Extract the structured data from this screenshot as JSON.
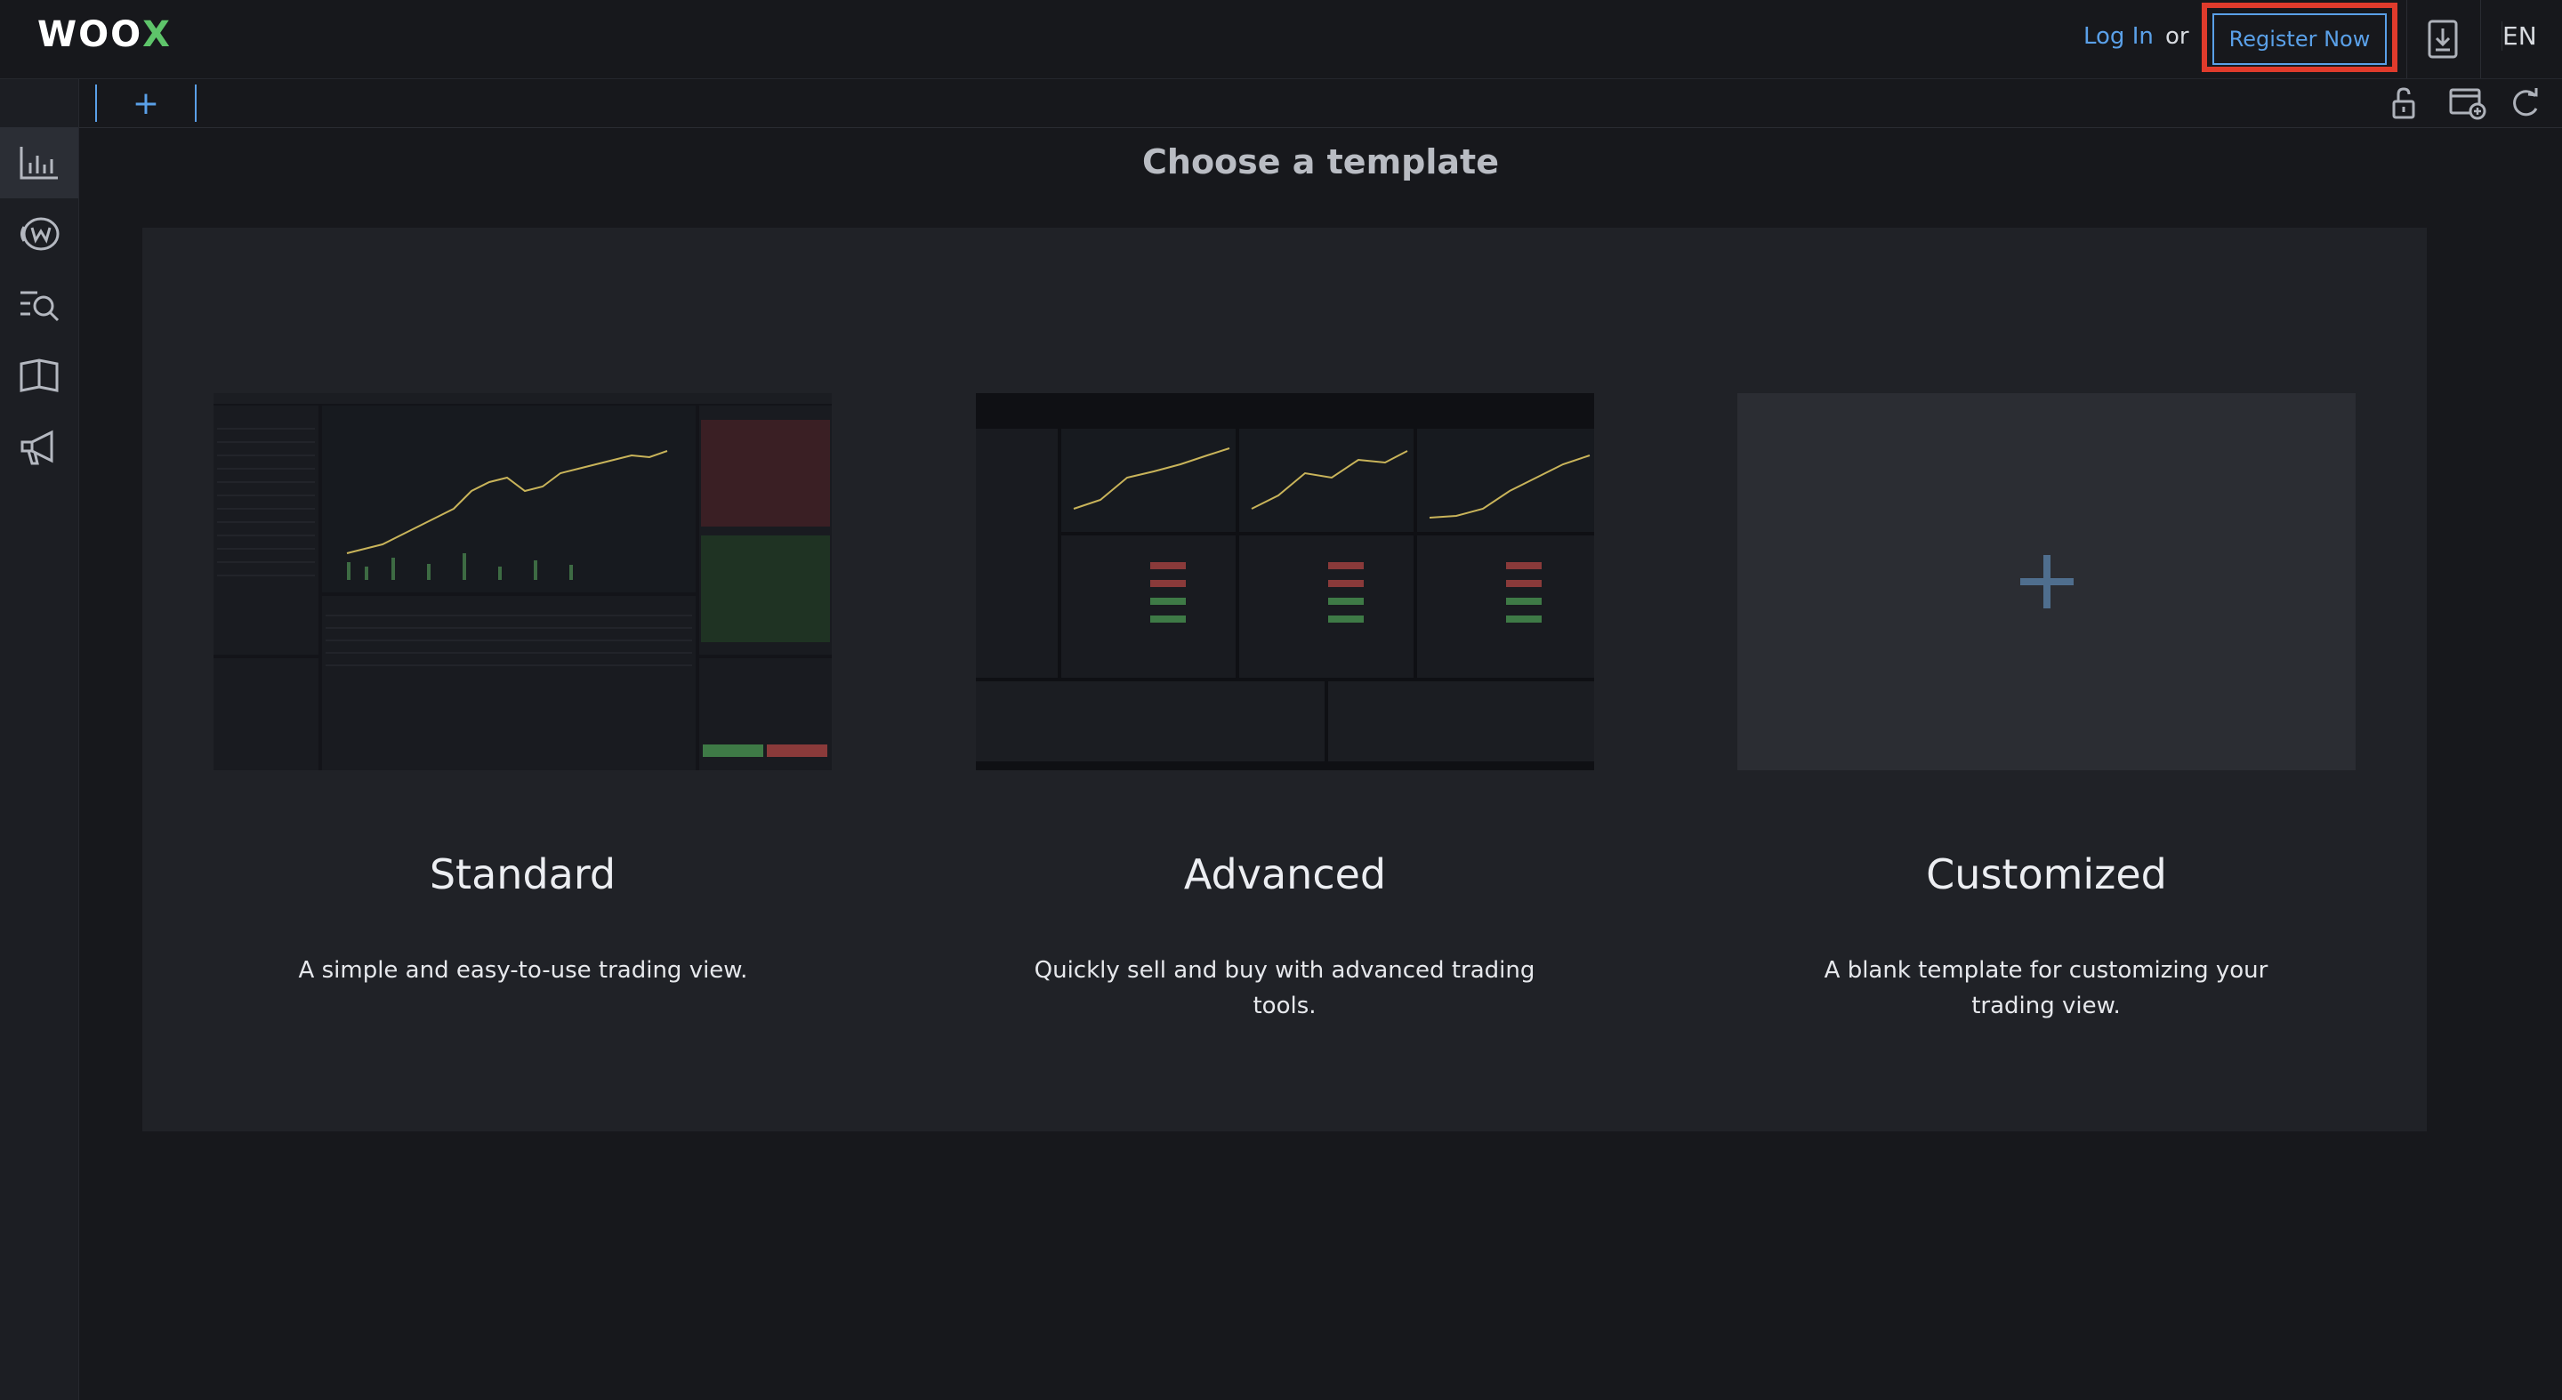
{
  "header": {
    "logo_main": "WOO",
    "logo_accent": "X",
    "login_label": "Log In",
    "or_label": "or",
    "register_label": "Register Now",
    "language_label": "EN"
  },
  "tabs": {
    "add_label": "+"
  },
  "sidebar": {
    "items": [
      {
        "icon": "chart-bars-icon",
        "active": true
      },
      {
        "icon": "woo-token-icon",
        "active": false
      },
      {
        "icon": "search-list-icon",
        "active": false
      },
      {
        "icon": "book-icon",
        "active": false
      },
      {
        "icon": "megaphone-icon",
        "active": false
      }
    ]
  },
  "toolbar_icons": [
    "unlock-icon",
    "window-add-icon",
    "refresh-icon"
  ],
  "main": {
    "title": "Choose a template",
    "templates": [
      {
        "name": "Standard",
        "description": "A simple and easy-to-use trading view."
      },
      {
        "name": "Advanced",
        "description": "Quickly sell and buy with advanced trading tools."
      },
      {
        "name": "Customized",
        "description": "A blank template for customizing your trading view.",
        "placeholder_symbol": "+"
      }
    ]
  },
  "colors": {
    "accent": "#5aa0e8",
    "highlight": "#e03b2c",
    "brand_green": "#5ec46a",
    "background": "#17181c",
    "panel": "#202227"
  }
}
